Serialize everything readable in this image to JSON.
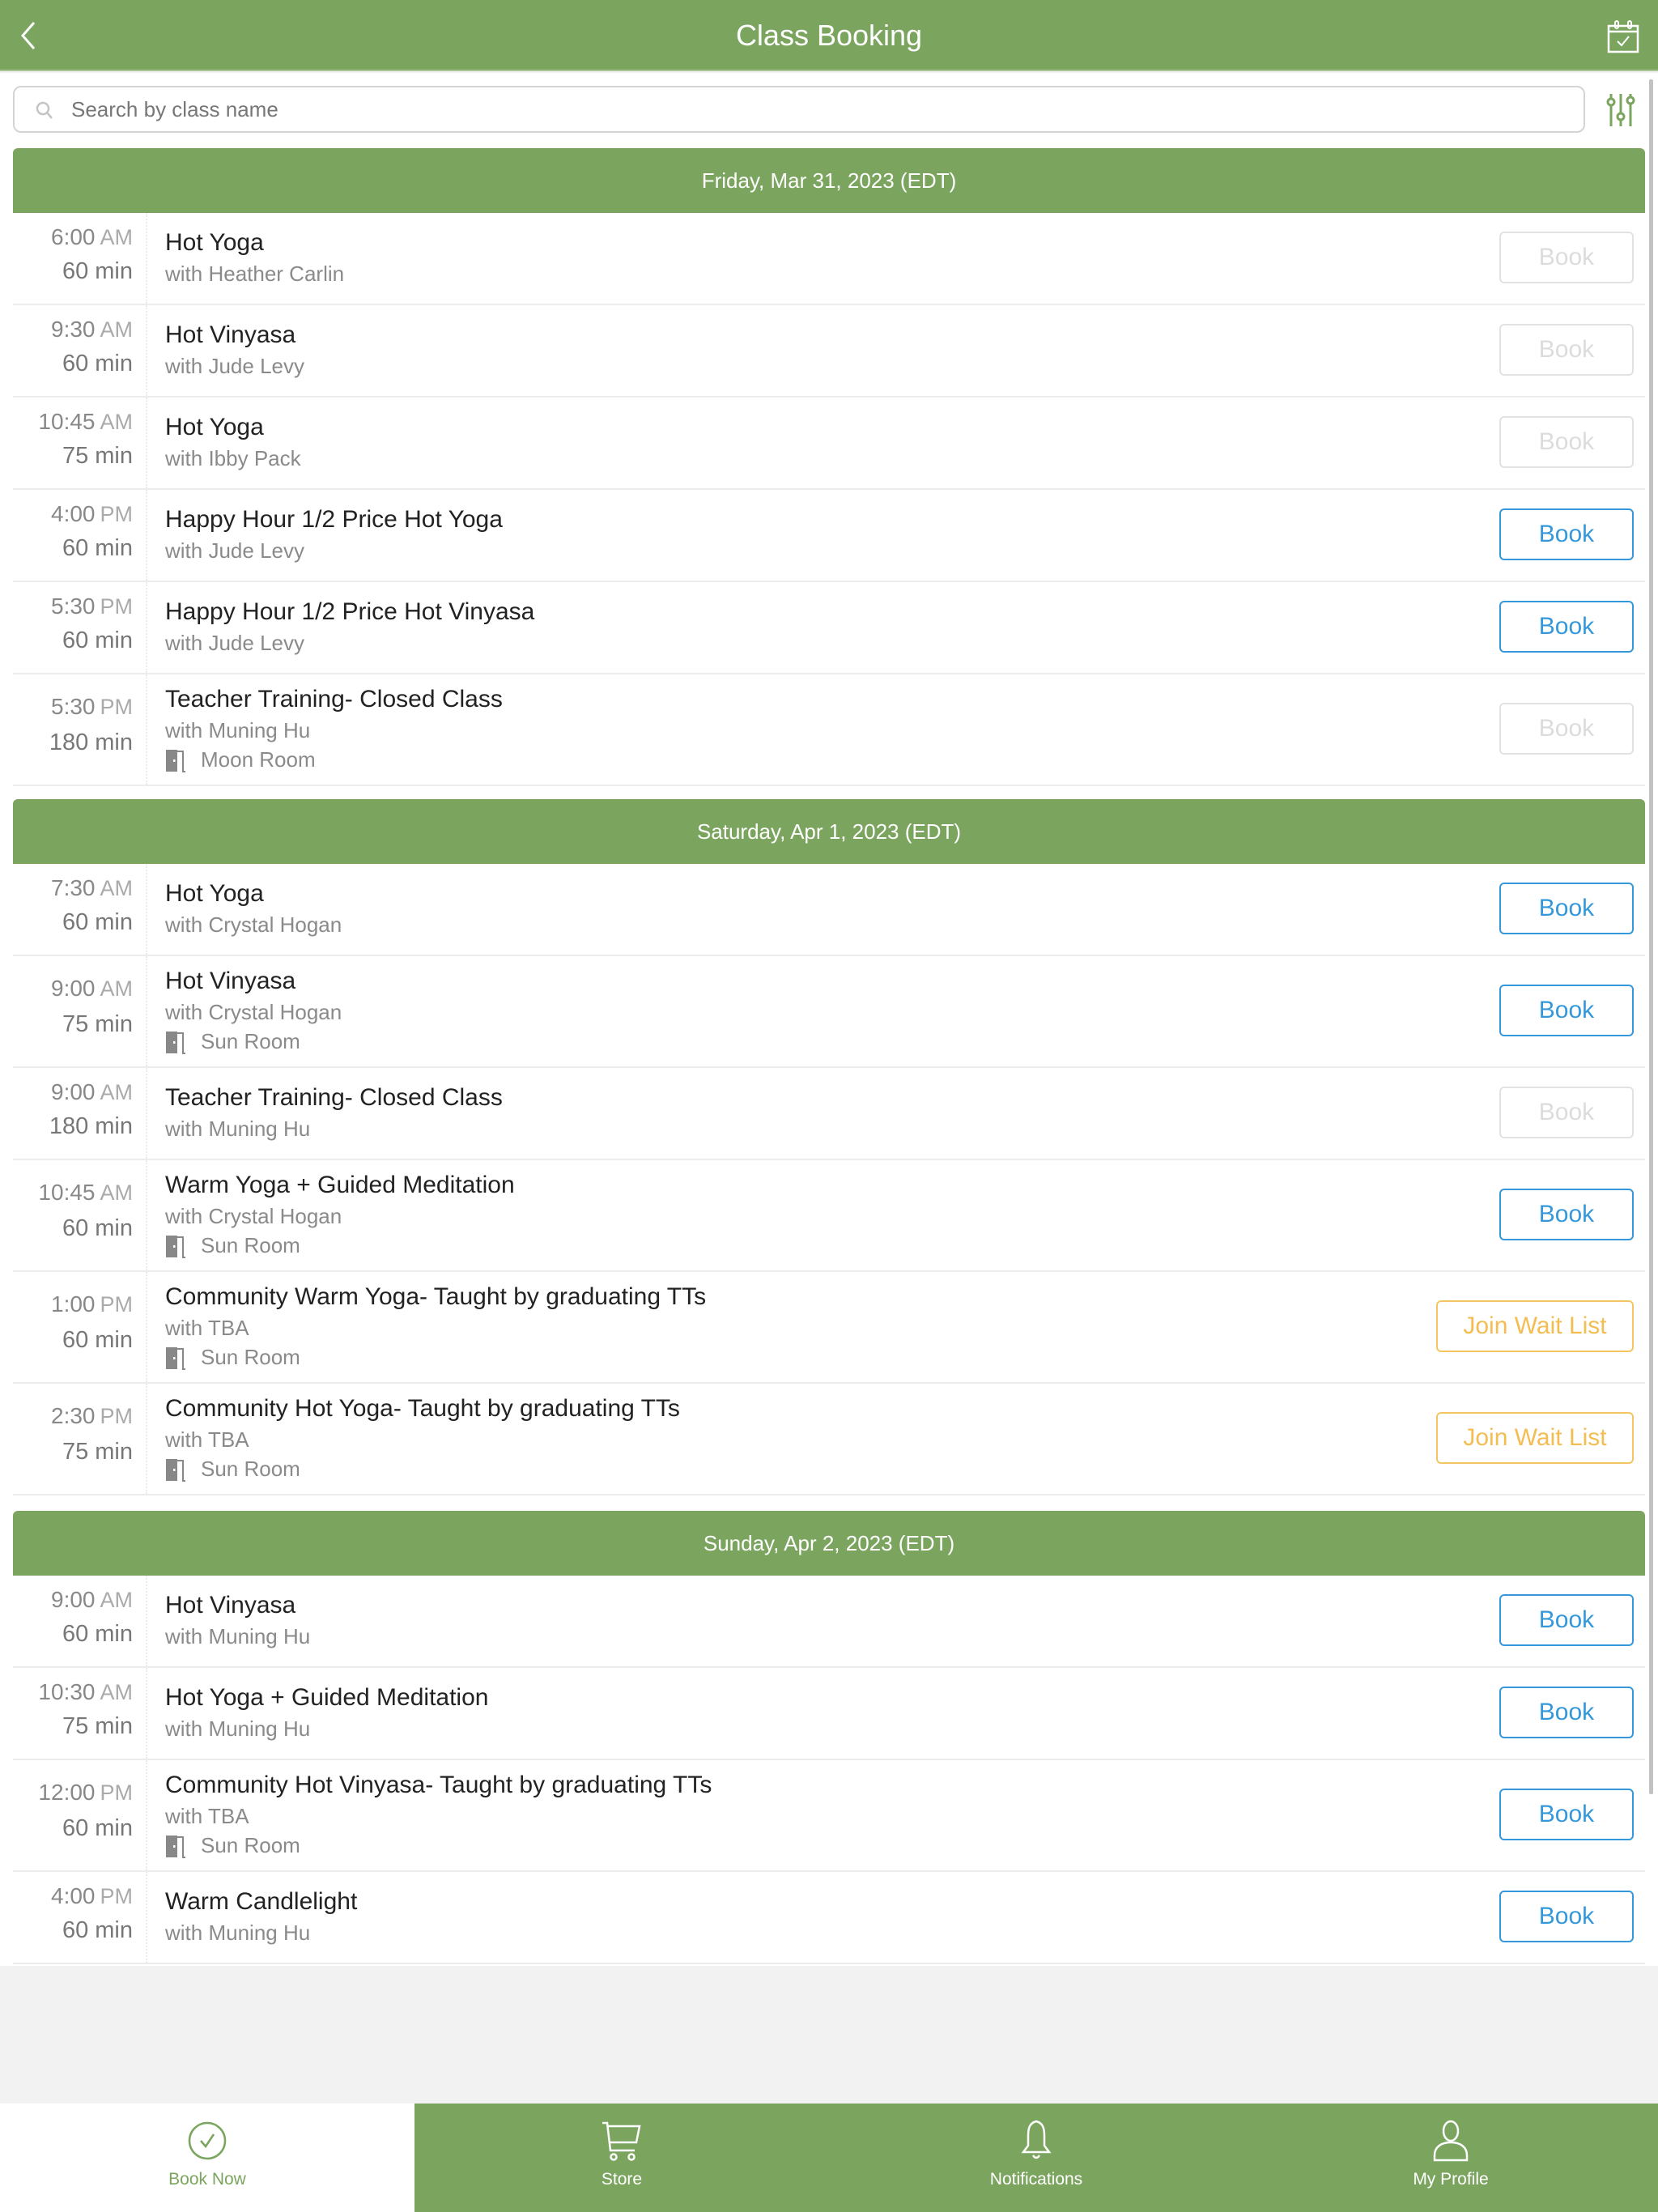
{
  "header": {
    "title": "Class Booking",
    "back_icon": "chevron-left-icon",
    "calendar_icon": "calendar-check-icon"
  },
  "search": {
    "placeholder": "Search by class name",
    "value": "",
    "filter_icon": "sliders-icon"
  },
  "days": [
    {
      "label": "Friday, Mar 31, 2023 (EDT)",
      "classes": [
        {
          "time": "6:00",
          "ampm": "AM",
          "duration": "60 min",
          "name": "Hot Yoga",
          "instructor": "with Heather Carlin",
          "room": null,
          "action": "Book",
          "state": "disabled"
        },
        {
          "time": "9:30",
          "ampm": "AM",
          "duration": "60 min",
          "name": "Hot Vinyasa",
          "instructor": "with Jude Levy",
          "room": null,
          "action": "Book",
          "state": "disabled"
        },
        {
          "time": "10:45",
          "ampm": "AM",
          "duration": "75 min",
          "name": "Hot Yoga",
          "instructor": "with Ibby Pack",
          "room": null,
          "action": "Book",
          "state": "disabled"
        },
        {
          "time": "4:00",
          "ampm": "PM",
          "duration": "60 min",
          "name": "Happy Hour 1/2 Price Hot Yoga",
          "instructor": "with Jude Levy",
          "room": null,
          "action": "Book",
          "state": "enabled"
        },
        {
          "time": "5:30",
          "ampm": "PM",
          "duration": "60 min",
          "name": "Happy Hour 1/2 Price Hot Vinyasa",
          "instructor": "with Jude Levy",
          "room": null,
          "action": "Book",
          "state": "enabled"
        },
        {
          "time": "5:30",
          "ampm": "PM",
          "duration": "180 min",
          "name": "Teacher Training- Closed Class",
          "instructor": "with Muning Hu",
          "room": "Moon Room",
          "action": "Book",
          "state": "disabled"
        }
      ]
    },
    {
      "label": "Saturday, Apr 1, 2023 (EDT)",
      "classes": [
        {
          "time": "7:30",
          "ampm": "AM",
          "duration": "60 min",
          "name": "Hot Yoga",
          "instructor": "with Crystal Hogan",
          "room": null,
          "action": "Book",
          "state": "enabled"
        },
        {
          "time": "9:00",
          "ampm": "AM",
          "duration": "75 min",
          "name": "Hot Vinyasa",
          "instructor": "with Crystal Hogan",
          "room": "Sun Room",
          "action": "Book",
          "state": "enabled"
        },
        {
          "time": "9:00",
          "ampm": "AM",
          "duration": "180 min",
          "name": "Teacher Training- Closed Class",
          "instructor": "with Muning Hu",
          "room": null,
          "action": "Book",
          "state": "disabled"
        },
        {
          "time": "10:45",
          "ampm": "AM",
          "duration": "60 min",
          "name": "Warm Yoga + Guided Meditation",
          "instructor": "with Crystal Hogan",
          "room": "Sun Room",
          "action": "Book",
          "state": "enabled"
        },
        {
          "time": "1:00",
          "ampm": "PM",
          "duration": "60 min",
          "name": "Community Warm Yoga- Taught by graduating TTs",
          "instructor": "with TBA",
          "room": "Sun Room",
          "action": "Join Wait List",
          "state": "waitlist"
        },
        {
          "time": "2:30",
          "ampm": "PM",
          "duration": "75 min",
          "name": "Community Hot Yoga- Taught by graduating TTs",
          "instructor": "with TBA",
          "room": "Sun Room",
          "action": "Join Wait List",
          "state": "waitlist"
        }
      ]
    },
    {
      "label": "Sunday, Apr 2, 2023 (EDT)",
      "classes": [
        {
          "time": "9:00",
          "ampm": "AM",
          "duration": "60 min",
          "name": "Hot Vinyasa",
          "instructor": "with Muning Hu",
          "room": null,
          "action": "Book",
          "state": "enabled"
        },
        {
          "time": "10:30",
          "ampm": "AM",
          "duration": "75 min",
          "name": "Hot Yoga + Guided Meditation",
          "instructor": "with Muning Hu",
          "room": null,
          "action": "Book",
          "state": "enabled"
        },
        {
          "time": "12:00",
          "ampm": "PM",
          "duration": "60 min",
          "name": "Community Hot Vinyasa- Taught by graduating TTs",
          "instructor": "with TBA",
          "room": "Sun Room",
          "action": "Book",
          "state": "enabled"
        },
        {
          "time": "4:00",
          "ampm": "PM",
          "duration": "60 min",
          "name": "Warm Candlelight",
          "instructor": "with Muning Hu",
          "room": null,
          "action": "Book",
          "state": "enabled"
        }
      ]
    }
  ],
  "bottom_nav": [
    {
      "label": "Book Now",
      "icon": "check-circle-icon",
      "active": true
    },
    {
      "label": "Store",
      "icon": "cart-icon",
      "active": false
    },
    {
      "label": "Notifications",
      "icon": "bell-icon",
      "active": false
    },
    {
      "label": "My Profile",
      "icon": "user-icon",
      "active": false
    }
  ],
  "colors": {
    "brand_green": "#7ba55f",
    "book_blue": "#3498db",
    "waitlist_amber": "#f3bd52",
    "disabled_gray": "#dcdcdc"
  }
}
